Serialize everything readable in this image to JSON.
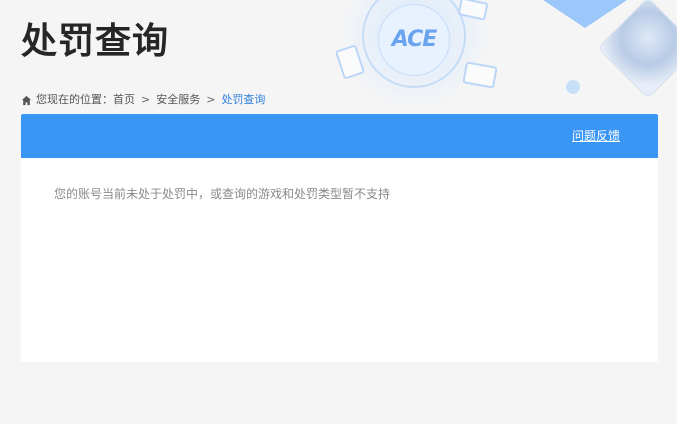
{
  "page": {
    "title": "处罚查询"
  },
  "banner": {
    "logo_text": "ACE",
    "decorations": [
      "game-card-icon",
      "game-card-icon",
      "game-card-icon",
      "character-avatar"
    ]
  },
  "breadcrumb": {
    "icon": "home-icon",
    "prefix": "您现在的位置：",
    "items": [
      "首页",
      "安全服务",
      "处罚查询"
    ],
    "separator": ">"
  },
  "panel": {
    "feedback_label": "问题反馈",
    "message": "您的账号当前未处于处罚中，或查询的游戏和处罚类型暂不支持"
  },
  "colors": {
    "accent": "#3a96f5",
    "current_crumb": "#2f7fdc",
    "background": "#f5f5f5"
  }
}
